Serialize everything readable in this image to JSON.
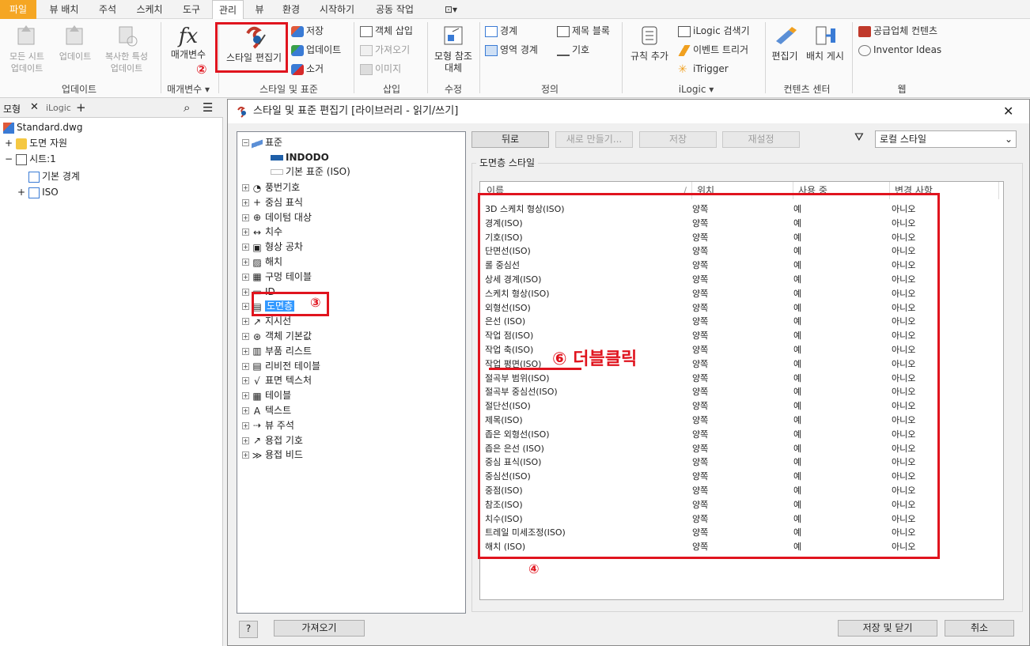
{
  "menu": {
    "items": [
      "파일",
      "뷰 배치",
      "주석",
      "스케치",
      "도구",
      "관리",
      "뷰",
      "환경",
      "시작하기",
      "공동 작업"
    ],
    "active": "관리"
  },
  "ribbon": {
    "update_all_sheets": "모든 시트\n업데이트",
    "update": "업데이트",
    "update_copied": "복사한 특성\n업데이트",
    "group_update": "업데이트",
    "parameters": "매개변수",
    "group_parameters": "매개변수 ▾",
    "style_editor": "스타일 편집기",
    "save": "저장",
    "update2": "업데이트",
    "purge": "소거",
    "group_styles": "스타일 및 표준",
    "insert_object": "객체 삽입",
    "import": "가져오기",
    "image": "이미지",
    "group_insert": "삽입",
    "replace_model_ref": "모형 참조\n대체",
    "group_modify": "수정",
    "border": "경계",
    "title_block": "제목 블록",
    "zone_border": "영역 경계",
    "symbol": "기호",
    "group_define": "정의",
    "add_rule": "규칙 추가",
    "ilogic_browser": "iLogic 검색기",
    "event_trigger": "이벤트 트리거",
    "itrigger": "iTrigger",
    "group_ilogic": "iLogic ▾",
    "edit": "편집기",
    "publish": "배치 게시",
    "group_content": "컨텐츠 센터",
    "supplier_content": "공급업체 컨텐츠",
    "inventor_ideas": "Inventor Ideas",
    "group_web": "웹"
  },
  "left_panel": {
    "tab_model": "모형",
    "tab_ilogic": "iLogic",
    "tree": [
      "Standard.dwg",
      "도면 자원",
      "시트:1",
      "기본 경계",
      "ISO"
    ]
  },
  "dialog": {
    "title": "스타일 및 표준 편집기 [라이브러리 - 읽기/쓰기]",
    "tree": {
      "root": "표준",
      "standard_children": [
        "INDODO",
        "기본 표준 (ISO)"
      ],
      "items": [
        "풍번기호",
        "중심 표식",
        "데이텀 대상",
        "치수",
        "형상 공차",
        "해치",
        "구멍 테이블",
        "ID",
        "도면층",
        "지시선",
        "객체 기본값",
        "부품 리스트",
        "리비전 테이블",
        "표면 텍스처",
        "테이블",
        "텍스트",
        "뷰 주석",
        "용접 기호",
        "용접 비드"
      ],
      "selected": "도면층"
    },
    "buttons": {
      "back": "뒤로",
      "new": "새로 만들기...",
      "save": "저장",
      "reset": "재설정",
      "import": "가져오기",
      "save_close": "저장 및 닫기",
      "cancel": "취소",
      "help": "?"
    },
    "filter_value": "로컬 스타일",
    "group_label": "도면층 스타일",
    "columns": [
      "이름",
      "위치",
      "사용 중",
      "변경 사항"
    ],
    "rows": [
      [
        "3D 스케치 형상(ISO)",
        "양쪽",
        "예",
        "아니오"
      ],
      [
        "경계(ISO)",
        "양쪽",
        "예",
        "아니오"
      ],
      [
        "기호(ISO)",
        "양쪽",
        "예",
        "아니오"
      ],
      [
        "단면선(ISO)",
        "양쪽",
        "예",
        "아니오"
      ],
      [
        "롤 중심선",
        "양쪽",
        "예",
        "아니오"
      ],
      [
        "상세 경계(ISO)",
        "양쪽",
        "예",
        "아니오"
      ],
      [
        "스케치 형상(ISO)",
        "양쪽",
        "예",
        "아니오"
      ],
      [
        "외형선(ISO)",
        "양쪽",
        "예",
        "아니오"
      ],
      [
        "은선 (ISO)",
        "양쪽",
        "예",
        "아니오"
      ],
      [
        "작업 점(ISO)",
        "양쪽",
        "예",
        "아니오"
      ],
      [
        "작업 축(ISO)",
        "양쪽",
        "예",
        "아니오"
      ],
      [
        "작업 평면(ISO)",
        "양쪽",
        "예",
        "아니오"
      ],
      [
        "절곡부 범위(ISO)",
        "양쪽",
        "예",
        "아니오"
      ],
      [
        "절곡부 중심선(ISO)",
        "양쪽",
        "예",
        "아니오"
      ],
      [
        "절단선(ISO)",
        "양쪽",
        "예",
        "아니오"
      ],
      [
        "제목(ISO)",
        "양쪽",
        "예",
        "아니오"
      ],
      [
        "좁은 외형선(ISO)",
        "양쪽",
        "예",
        "아니오"
      ],
      [
        "좁은 은선 (ISO)",
        "양쪽",
        "예",
        "아니오"
      ],
      [
        "중심 표식(ISO)",
        "양쪽",
        "예",
        "아니오"
      ],
      [
        "중심선(ISO)",
        "양쪽",
        "예",
        "아니오"
      ],
      [
        "중점(ISO)",
        "양쪽",
        "예",
        "아니오"
      ],
      [
        "참조(ISO)",
        "양쪽",
        "예",
        "아니오"
      ],
      [
        "치수(ISO)",
        "양쪽",
        "예",
        "아니오"
      ],
      [
        "트레일 미세조정(ISO)",
        "양쪽",
        "예",
        "아니오"
      ],
      [
        "해치 (ISO)",
        "양쪽",
        "예",
        "아니오"
      ]
    ]
  },
  "annotations": {
    "step2": "②",
    "step3": "③",
    "step4": "④",
    "step6": "⑥ 더블클릭",
    "color": "#e0141e"
  }
}
